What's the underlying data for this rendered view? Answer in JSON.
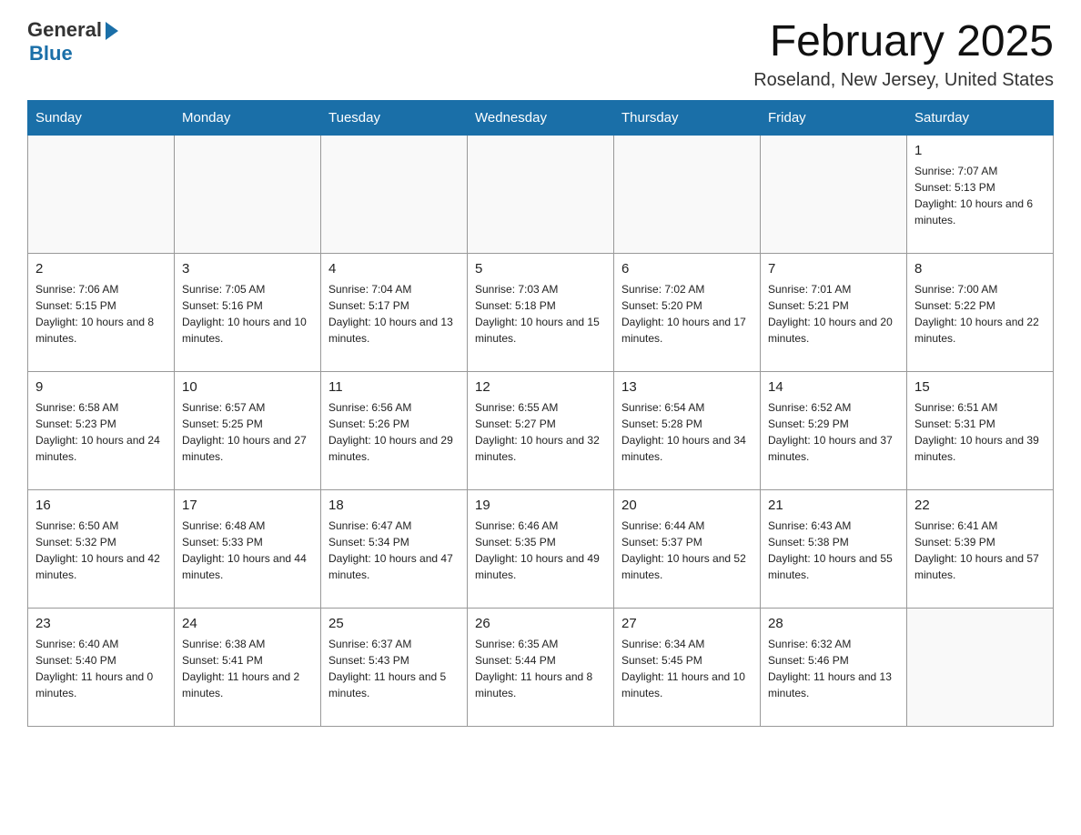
{
  "header": {
    "logo_general": "General",
    "logo_blue": "Blue",
    "month_title": "February 2025",
    "location": "Roseland, New Jersey, United States"
  },
  "days_of_week": [
    "Sunday",
    "Monday",
    "Tuesday",
    "Wednesday",
    "Thursday",
    "Friday",
    "Saturday"
  ],
  "weeks": [
    [
      {
        "day": "",
        "info": ""
      },
      {
        "day": "",
        "info": ""
      },
      {
        "day": "",
        "info": ""
      },
      {
        "day": "",
        "info": ""
      },
      {
        "day": "",
        "info": ""
      },
      {
        "day": "",
        "info": ""
      },
      {
        "day": "1",
        "info": "Sunrise: 7:07 AM\nSunset: 5:13 PM\nDaylight: 10 hours and 6 minutes."
      }
    ],
    [
      {
        "day": "2",
        "info": "Sunrise: 7:06 AM\nSunset: 5:15 PM\nDaylight: 10 hours and 8 minutes."
      },
      {
        "day": "3",
        "info": "Sunrise: 7:05 AM\nSunset: 5:16 PM\nDaylight: 10 hours and 10 minutes."
      },
      {
        "day": "4",
        "info": "Sunrise: 7:04 AM\nSunset: 5:17 PM\nDaylight: 10 hours and 13 minutes."
      },
      {
        "day": "5",
        "info": "Sunrise: 7:03 AM\nSunset: 5:18 PM\nDaylight: 10 hours and 15 minutes."
      },
      {
        "day": "6",
        "info": "Sunrise: 7:02 AM\nSunset: 5:20 PM\nDaylight: 10 hours and 17 minutes."
      },
      {
        "day": "7",
        "info": "Sunrise: 7:01 AM\nSunset: 5:21 PM\nDaylight: 10 hours and 20 minutes."
      },
      {
        "day": "8",
        "info": "Sunrise: 7:00 AM\nSunset: 5:22 PM\nDaylight: 10 hours and 22 minutes."
      }
    ],
    [
      {
        "day": "9",
        "info": "Sunrise: 6:58 AM\nSunset: 5:23 PM\nDaylight: 10 hours and 24 minutes."
      },
      {
        "day": "10",
        "info": "Sunrise: 6:57 AM\nSunset: 5:25 PM\nDaylight: 10 hours and 27 minutes."
      },
      {
        "day": "11",
        "info": "Sunrise: 6:56 AM\nSunset: 5:26 PM\nDaylight: 10 hours and 29 minutes."
      },
      {
        "day": "12",
        "info": "Sunrise: 6:55 AM\nSunset: 5:27 PM\nDaylight: 10 hours and 32 minutes."
      },
      {
        "day": "13",
        "info": "Sunrise: 6:54 AM\nSunset: 5:28 PM\nDaylight: 10 hours and 34 minutes."
      },
      {
        "day": "14",
        "info": "Sunrise: 6:52 AM\nSunset: 5:29 PM\nDaylight: 10 hours and 37 minutes."
      },
      {
        "day": "15",
        "info": "Sunrise: 6:51 AM\nSunset: 5:31 PM\nDaylight: 10 hours and 39 minutes."
      }
    ],
    [
      {
        "day": "16",
        "info": "Sunrise: 6:50 AM\nSunset: 5:32 PM\nDaylight: 10 hours and 42 minutes."
      },
      {
        "day": "17",
        "info": "Sunrise: 6:48 AM\nSunset: 5:33 PM\nDaylight: 10 hours and 44 minutes."
      },
      {
        "day": "18",
        "info": "Sunrise: 6:47 AM\nSunset: 5:34 PM\nDaylight: 10 hours and 47 minutes."
      },
      {
        "day": "19",
        "info": "Sunrise: 6:46 AM\nSunset: 5:35 PM\nDaylight: 10 hours and 49 minutes."
      },
      {
        "day": "20",
        "info": "Sunrise: 6:44 AM\nSunset: 5:37 PM\nDaylight: 10 hours and 52 minutes."
      },
      {
        "day": "21",
        "info": "Sunrise: 6:43 AM\nSunset: 5:38 PM\nDaylight: 10 hours and 55 minutes."
      },
      {
        "day": "22",
        "info": "Sunrise: 6:41 AM\nSunset: 5:39 PM\nDaylight: 10 hours and 57 minutes."
      }
    ],
    [
      {
        "day": "23",
        "info": "Sunrise: 6:40 AM\nSunset: 5:40 PM\nDaylight: 11 hours and 0 minutes."
      },
      {
        "day": "24",
        "info": "Sunrise: 6:38 AM\nSunset: 5:41 PM\nDaylight: 11 hours and 2 minutes."
      },
      {
        "day": "25",
        "info": "Sunrise: 6:37 AM\nSunset: 5:43 PM\nDaylight: 11 hours and 5 minutes."
      },
      {
        "day": "26",
        "info": "Sunrise: 6:35 AM\nSunset: 5:44 PM\nDaylight: 11 hours and 8 minutes."
      },
      {
        "day": "27",
        "info": "Sunrise: 6:34 AM\nSunset: 5:45 PM\nDaylight: 11 hours and 10 minutes."
      },
      {
        "day": "28",
        "info": "Sunrise: 6:32 AM\nSunset: 5:46 PM\nDaylight: 11 hours and 13 minutes."
      },
      {
        "day": "",
        "info": ""
      }
    ]
  ]
}
